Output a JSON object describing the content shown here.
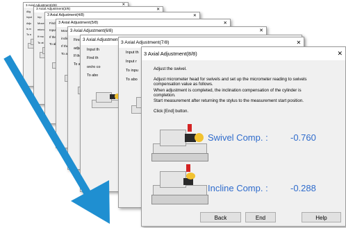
{
  "windows": [
    {
      "title": "3 Axial Adjustment(2/8)",
      "lines": [
        "Alig",
        "Input",
        "Adju",
        "Is m",
        "To a"
      ]
    },
    {
      "title": "3 Axial Adjustment(3/8)",
      "lines": [
        "Inp",
        "Move",
        "micro",
        "If mo",
        "To at"
      ]
    },
    {
      "title": "3 Axial Adjustment(4/8)",
      "lines": [
        "Find",
        "Input",
        "If the",
        "To ab"
      ]
    },
    {
      "title": "3 Axial Adjustment(5/8)",
      "lines": [
        "Move",
        "incline",
        "If the r",
        "To abo"
      ]
    },
    {
      "title": "3 Axial Adjustment(6/8)",
      "lines": [
        "Find th",
        "adjustm",
        "If the a",
        "To abo"
      ]
    },
    {
      "title": "3 Axial Adjustment(6/8)",
      "lines": [
        "Input th",
        "Find th",
        "on/ro co",
        "To abo"
      ]
    },
    {
      "title": "3 Axial Adjustment(7/8)",
      "lines": [
        "Input th",
        "Input r",
        "To inpu",
        "To abo"
      ]
    }
  ],
  "main": {
    "title": "3 Axial Adjustment(8/8)",
    "close_glyph": "✕",
    "instruction": "Adjust the swivel.",
    "para": [
      "Adjust micrometer head for swivels and set up the micrometer reading to swivels",
      "compensation value as follows.",
      "When adjustment is completed, the inclination compensation of the cylinder is",
      "completion.",
      "Start measurement after returning the stylus to the measurement start position."
    ],
    "click_text": "Click [End] button.",
    "swivel": {
      "label": "Swivel Comp. :",
      "value": "-0.760"
    },
    "incline": {
      "label": "Incline Comp. :",
      "value": "-0.288"
    },
    "buttons": {
      "back": "Back",
      "end": "End",
      "help": "Help"
    }
  },
  "colors": {
    "accent": "#2e6bcc",
    "arrow": "#1f8fd1"
  }
}
